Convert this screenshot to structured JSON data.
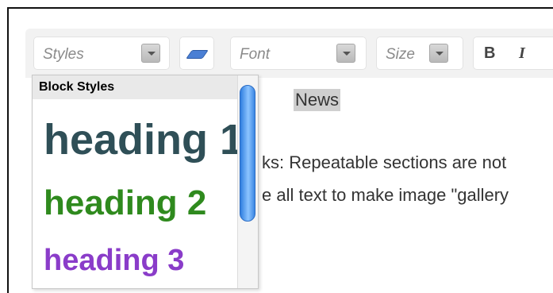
{
  "toolbar": {
    "styles_label": "Styles",
    "font_label": "Font",
    "size_label": "Size",
    "bold_label": "B",
    "italic_label": "I"
  },
  "content": {
    "news_heading": "News",
    "line1": "ks: Repeatable sections are not",
    "line2": "e all text to make image \"gallery"
  },
  "styles_dropdown": {
    "header": "Block Styles",
    "items": [
      {
        "label": "heading 1",
        "color": "#2f4f57"
      },
      {
        "label": "heading 2",
        "color": "#2f8a1e"
      },
      {
        "label": "heading 3",
        "color": "#8a3cc9"
      }
    ]
  }
}
